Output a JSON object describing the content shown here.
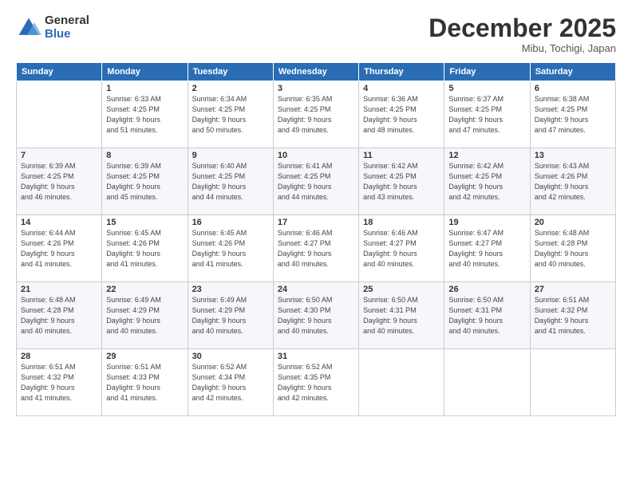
{
  "logo": {
    "general": "General",
    "blue": "Blue"
  },
  "header": {
    "month": "December 2025",
    "location": "Mibu, Tochigi, Japan"
  },
  "weekdays": [
    "Sunday",
    "Monday",
    "Tuesday",
    "Wednesday",
    "Thursday",
    "Friday",
    "Saturday"
  ],
  "weeks": [
    [
      {
        "day": "",
        "info": ""
      },
      {
        "day": "1",
        "info": "Sunrise: 6:33 AM\nSunset: 4:25 PM\nDaylight: 9 hours\nand 51 minutes."
      },
      {
        "day": "2",
        "info": "Sunrise: 6:34 AM\nSunset: 4:25 PM\nDaylight: 9 hours\nand 50 minutes."
      },
      {
        "day": "3",
        "info": "Sunrise: 6:35 AM\nSunset: 4:25 PM\nDaylight: 9 hours\nand 49 minutes."
      },
      {
        "day": "4",
        "info": "Sunrise: 6:36 AM\nSunset: 4:25 PM\nDaylight: 9 hours\nand 48 minutes."
      },
      {
        "day": "5",
        "info": "Sunrise: 6:37 AM\nSunset: 4:25 PM\nDaylight: 9 hours\nand 47 minutes."
      },
      {
        "day": "6",
        "info": "Sunrise: 6:38 AM\nSunset: 4:25 PM\nDaylight: 9 hours\nand 47 minutes."
      }
    ],
    [
      {
        "day": "7",
        "info": "Sunrise: 6:39 AM\nSunset: 4:25 PM\nDaylight: 9 hours\nand 46 minutes."
      },
      {
        "day": "8",
        "info": "Sunrise: 6:39 AM\nSunset: 4:25 PM\nDaylight: 9 hours\nand 45 minutes."
      },
      {
        "day": "9",
        "info": "Sunrise: 6:40 AM\nSunset: 4:25 PM\nDaylight: 9 hours\nand 44 minutes."
      },
      {
        "day": "10",
        "info": "Sunrise: 6:41 AM\nSunset: 4:25 PM\nDaylight: 9 hours\nand 44 minutes."
      },
      {
        "day": "11",
        "info": "Sunrise: 6:42 AM\nSunset: 4:25 PM\nDaylight: 9 hours\nand 43 minutes."
      },
      {
        "day": "12",
        "info": "Sunrise: 6:42 AM\nSunset: 4:25 PM\nDaylight: 9 hours\nand 42 minutes."
      },
      {
        "day": "13",
        "info": "Sunrise: 6:43 AM\nSunset: 4:26 PM\nDaylight: 9 hours\nand 42 minutes."
      }
    ],
    [
      {
        "day": "14",
        "info": "Sunrise: 6:44 AM\nSunset: 4:26 PM\nDaylight: 9 hours\nand 41 minutes."
      },
      {
        "day": "15",
        "info": "Sunrise: 6:45 AM\nSunset: 4:26 PM\nDaylight: 9 hours\nand 41 minutes."
      },
      {
        "day": "16",
        "info": "Sunrise: 6:45 AM\nSunset: 4:26 PM\nDaylight: 9 hours\nand 41 minutes."
      },
      {
        "day": "17",
        "info": "Sunrise: 6:46 AM\nSunset: 4:27 PM\nDaylight: 9 hours\nand 40 minutes."
      },
      {
        "day": "18",
        "info": "Sunrise: 6:46 AM\nSunset: 4:27 PM\nDaylight: 9 hours\nand 40 minutes."
      },
      {
        "day": "19",
        "info": "Sunrise: 6:47 AM\nSunset: 4:27 PM\nDaylight: 9 hours\nand 40 minutes."
      },
      {
        "day": "20",
        "info": "Sunrise: 6:48 AM\nSunset: 4:28 PM\nDaylight: 9 hours\nand 40 minutes."
      }
    ],
    [
      {
        "day": "21",
        "info": "Sunrise: 6:48 AM\nSunset: 4:28 PM\nDaylight: 9 hours\nand 40 minutes."
      },
      {
        "day": "22",
        "info": "Sunrise: 6:49 AM\nSunset: 4:29 PM\nDaylight: 9 hours\nand 40 minutes."
      },
      {
        "day": "23",
        "info": "Sunrise: 6:49 AM\nSunset: 4:29 PM\nDaylight: 9 hours\nand 40 minutes."
      },
      {
        "day": "24",
        "info": "Sunrise: 6:50 AM\nSunset: 4:30 PM\nDaylight: 9 hours\nand 40 minutes."
      },
      {
        "day": "25",
        "info": "Sunrise: 6:50 AM\nSunset: 4:31 PM\nDaylight: 9 hours\nand 40 minutes."
      },
      {
        "day": "26",
        "info": "Sunrise: 6:50 AM\nSunset: 4:31 PM\nDaylight: 9 hours\nand 40 minutes."
      },
      {
        "day": "27",
        "info": "Sunrise: 6:51 AM\nSunset: 4:32 PM\nDaylight: 9 hours\nand 41 minutes."
      }
    ],
    [
      {
        "day": "28",
        "info": "Sunrise: 6:51 AM\nSunset: 4:32 PM\nDaylight: 9 hours\nand 41 minutes."
      },
      {
        "day": "29",
        "info": "Sunrise: 6:51 AM\nSunset: 4:33 PM\nDaylight: 9 hours\nand 41 minutes."
      },
      {
        "day": "30",
        "info": "Sunrise: 6:52 AM\nSunset: 4:34 PM\nDaylight: 9 hours\nand 42 minutes."
      },
      {
        "day": "31",
        "info": "Sunrise: 6:52 AM\nSunset: 4:35 PM\nDaylight: 9 hours\nand 42 minutes."
      },
      {
        "day": "",
        "info": ""
      },
      {
        "day": "",
        "info": ""
      },
      {
        "day": "",
        "info": ""
      }
    ]
  ]
}
